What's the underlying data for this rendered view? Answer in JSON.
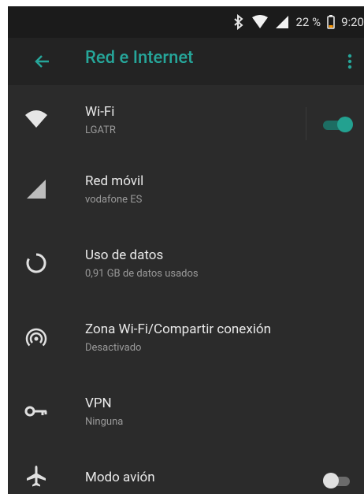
{
  "status_bar": {
    "battery_percent": "22 %",
    "time": "9:20"
  },
  "toolbar": {
    "title": "Red e Internet"
  },
  "items": [
    {
      "title": "Wi-Fi",
      "subtitle": "LGATR"
    },
    {
      "title": "Red móvil",
      "subtitle": "vodafone ES"
    },
    {
      "title": "Uso de datos",
      "subtitle": "0,91 GB de datos usados"
    },
    {
      "title": "Zona Wi-Fi/Compartir conexión",
      "subtitle": "Desactivado"
    },
    {
      "title": "VPN",
      "subtitle": "Ninguna"
    },
    {
      "title": "Modo avión",
      "subtitle": ""
    }
  ],
  "toggles": {
    "wifi": "on",
    "airplane": "off"
  },
  "colors": {
    "accent": "#26a69a",
    "background": "#2b2b2b",
    "toolbar": "#232323"
  }
}
